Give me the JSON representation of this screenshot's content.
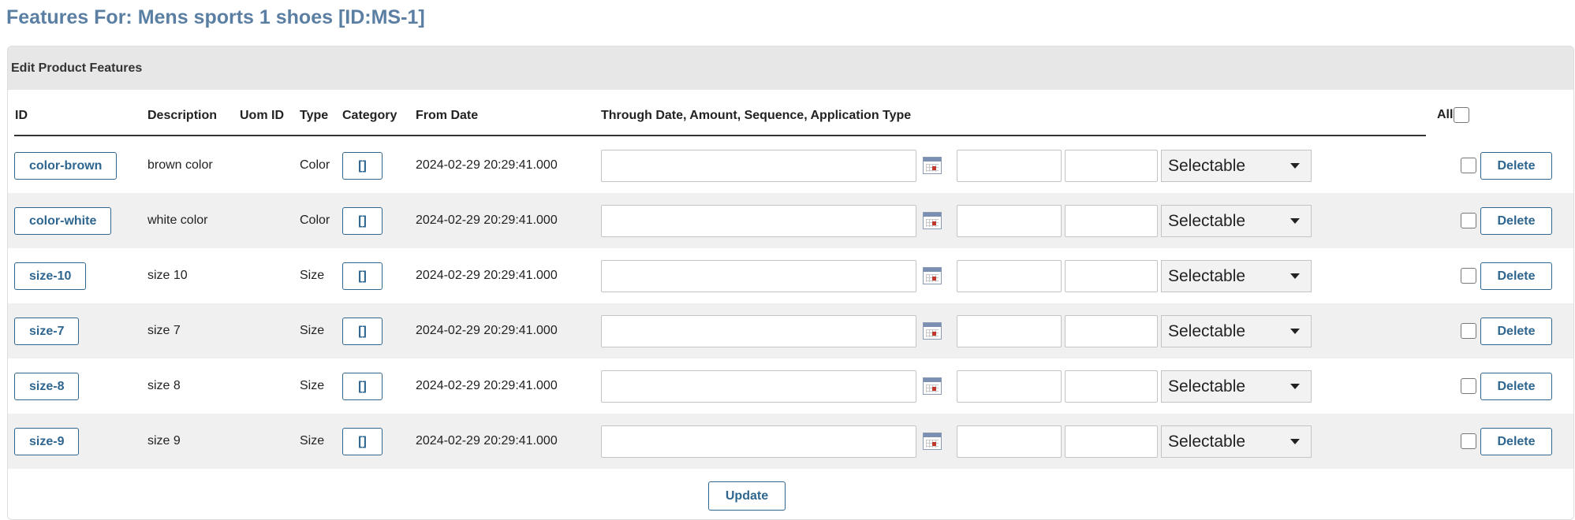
{
  "page": {
    "title": "Features For: Mens sports 1 shoes [ID:MS-1]"
  },
  "panel": {
    "title": "Edit Product Features"
  },
  "columns": {
    "id": "ID",
    "description": "Description",
    "uom_id": "Uom ID",
    "type": "Type",
    "category": "Category",
    "from_date": "From Date",
    "through": "Through Date, Amount, Sequence, Application Type",
    "all": "All"
  },
  "rows": [
    {
      "id": "color-brown",
      "description": "brown color",
      "uom_id": "",
      "type": "Color",
      "category": "[]",
      "from_date": "2024-02-29 20:29:41.000",
      "through_date": "",
      "amount": "",
      "sequence": "",
      "application_type": "Selectable",
      "delete_label": "Delete"
    },
    {
      "id": "color-white",
      "description": "white color",
      "uom_id": "",
      "type": "Color",
      "category": "[]",
      "from_date": "2024-02-29 20:29:41.000",
      "through_date": "",
      "amount": "",
      "sequence": "",
      "application_type": "Selectable",
      "delete_label": "Delete"
    },
    {
      "id": "size-10",
      "description": "size 10",
      "uom_id": "",
      "type": "Size",
      "category": "[]",
      "from_date": "2024-02-29 20:29:41.000",
      "through_date": "",
      "amount": "",
      "sequence": "",
      "application_type": "Selectable",
      "delete_label": "Delete"
    },
    {
      "id": "size-7",
      "description": "size 7",
      "uom_id": "",
      "type": "Size",
      "category": "[]",
      "from_date": "2024-02-29 20:29:41.000",
      "through_date": "",
      "amount": "",
      "sequence": "",
      "application_type": "Selectable",
      "delete_label": "Delete"
    },
    {
      "id": "size-8",
      "description": "size 8",
      "uom_id": "",
      "type": "Size",
      "category": "[]",
      "from_date": "2024-02-29 20:29:41.000",
      "through_date": "",
      "amount": "",
      "sequence": "",
      "application_type": "Selectable",
      "delete_label": "Delete"
    },
    {
      "id": "size-9",
      "description": "size 9",
      "uom_id": "",
      "type": "Size",
      "category": "[]",
      "from_date": "2024-02-29 20:29:41.000",
      "through_date": "",
      "amount": "",
      "sequence": "",
      "application_type": "Selectable",
      "delete_label": "Delete"
    }
  ],
  "actions": {
    "update_label": "Update"
  },
  "icons": {
    "date_picker": "calendar-icon",
    "dropdown": "chevron-down-icon"
  },
  "colors": {
    "title": "#5a7fa3",
    "button_text": "#2f6690",
    "panel_header": "#e7e7e7",
    "row_alt": "#f0f0f0"
  }
}
